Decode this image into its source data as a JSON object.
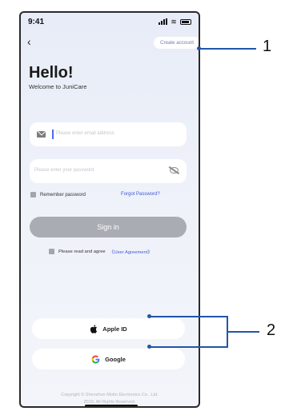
{
  "status": {
    "time": "9:41"
  },
  "nav": {
    "back_icon": "chevron-left-icon",
    "back_glyph": "‹",
    "create_account_label": "Create account"
  },
  "header": {
    "title": "Hello!",
    "subtitle": "Welcome to JuniCare"
  },
  "form": {
    "email_placeholder": "Please enter email address",
    "password_placeholder": "Please enter your password",
    "remember_label": "Remember password",
    "forgot_label": "Forgot Password?",
    "signin_label": "Sign in",
    "agree_label": "Please read and agree",
    "agreement_link": "《User Agreement》"
  },
  "social": {
    "apple_label": "Apple ID",
    "google_label": "Google"
  },
  "footer": {
    "copyright_line1": "Copyright © Shenzhen Motto Electronics Co., Ltd.",
    "copyright_line2": "2019. All Rights Reserved."
  },
  "callouts": {
    "label1": "1",
    "label2": "2"
  },
  "colors": {
    "accent": "#3d5bd9",
    "button_disabled": "#a9acb3",
    "callout": "#2255aa"
  }
}
